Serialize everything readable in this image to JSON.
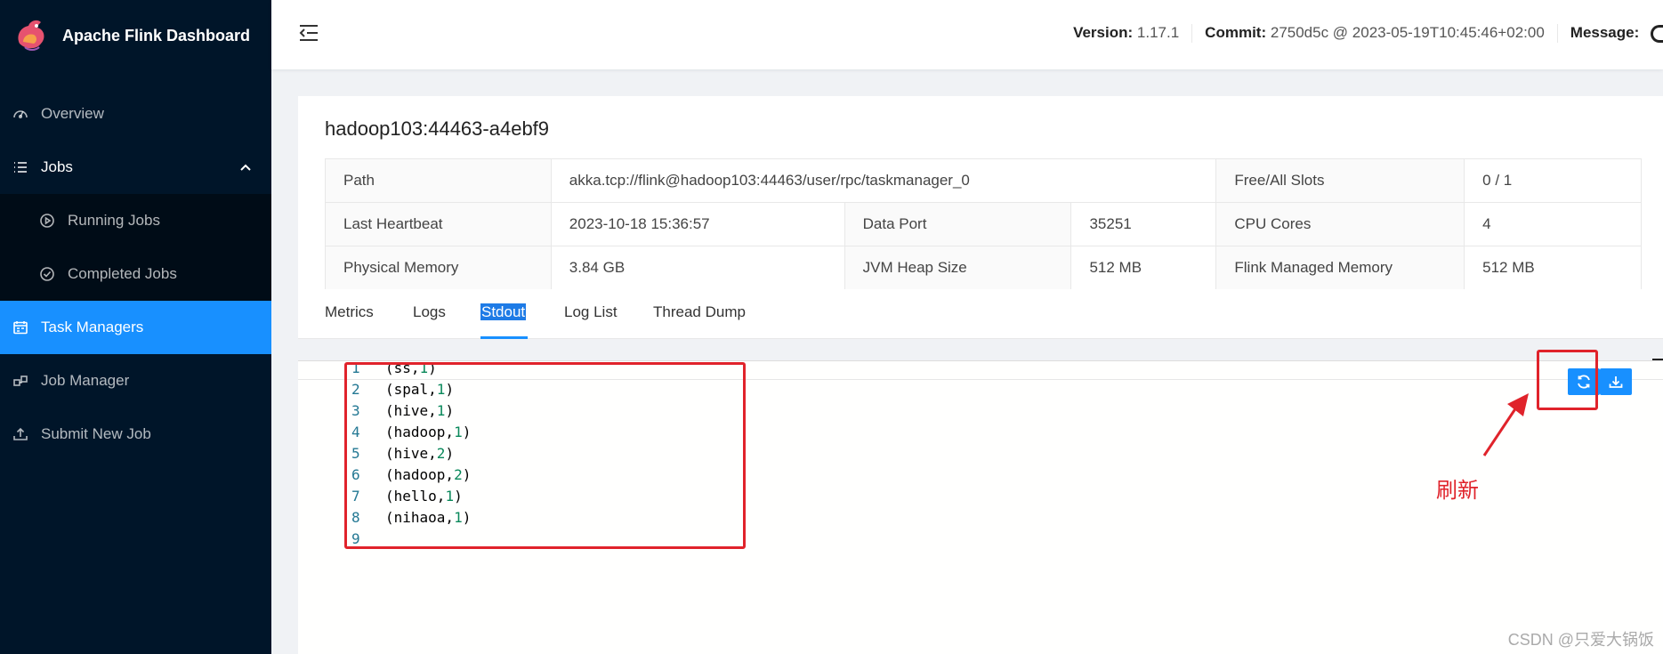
{
  "brand": {
    "title": "Apache Flink Dashboard"
  },
  "sidebar": {
    "items": [
      {
        "label": "Overview",
        "icon": "dashboard-icon"
      },
      {
        "label": "Jobs",
        "icon": "list-icon"
      },
      {
        "label": "Running Jobs",
        "icon": "play-circle-icon"
      },
      {
        "label": "Completed Jobs",
        "icon": "check-circle-icon"
      },
      {
        "label": "Task Managers",
        "icon": "schedule-icon"
      },
      {
        "label": "Job Manager",
        "icon": "cluster-icon"
      },
      {
        "label": "Submit New Job",
        "icon": "upload-icon"
      }
    ],
    "active": "Task Managers"
  },
  "header": {
    "version_label": "Version:",
    "version_value": "1.17.1",
    "commit_label": "Commit:",
    "commit_value": "2750d5c @ 2023-05-19T10:45:46+02:00",
    "message_label": "Message:"
  },
  "taskmanager": {
    "title": "hadoop103:44463-a4ebf9",
    "path_label": "Path",
    "path_value": "akka.tcp://flink@hadoop103:44463/user/rpc/taskmanager_0",
    "free_slots_label": "Free/All Slots",
    "free_slots_value": "0 / 1",
    "heartbeat_label": "Last Heartbeat",
    "heartbeat_value": "2023-10-18 15:36:57",
    "data_port_label": "Data Port",
    "data_port_value": "35251",
    "cpu_label": "CPU Cores",
    "cpu_value": "4",
    "phys_mem_label": "Physical Memory",
    "phys_mem_value": "3.84 GB",
    "jvm_heap_label": "JVM Heap Size",
    "jvm_heap_value": "512 MB",
    "managed_mem_label": "Flink Managed Memory",
    "managed_mem_value": "512 MB"
  },
  "tabs": [
    {
      "label": "Metrics"
    },
    {
      "label": "Logs"
    },
    {
      "label": "Stdout"
    },
    {
      "label": "Log List"
    },
    {
      "label": "Thread Dump"
    }
  ],
  "active_tab": "Stdout",
  "stdout": {
    "lines": [
      {
        "n": "1",
        "pre": "(ss,",
        "num": "1",
        "post": ")"
      },
      {
        "n": "2",
        "pre": "(spal,",
        "num": "1",
        "post": ")"
      },
      {
        "n": "3",
        "pre": "(hive,",
        "num": "1",
        "post": ")"
      },
      {
        "n": "4",
        "pre": "(hadoop,",
        "num": "1",
        "post": ")"
      },
      {
        "n": "5",
        "pre": "(hive,",
        "num": "2",
        "post": ")"
      },
      {
        "n": "6",
        "pre": "(hadoop,",
        "num": "2",
        "post": ")"
      },
      {
        "n": "7",
        "pre": "(hello,",
        "num": "1",
        "post": ")"
      },
      {
        "n": "8",
        "pre": "(nihaoa,",
        "num": "1",
        "post": ")"
      },
      {
        "n": "9",
        "pre": "",
        "num": "",
        "post": ""
      }
    ]
  },
  "buttons": {
    "refresh_icon": "reload-icon",
    "download_icon": "download-icon"
  },
  "annotation": {
    "label": "刷新",
    "color": "#e0232b"
  },
  "watermark": "CSDN @只爱大锅饭",
  "colors": {
    "sidebar_bg": "#001529",
    "accent": "#1890ff",
    "annotation_red": "#e0232b"
  }
}
